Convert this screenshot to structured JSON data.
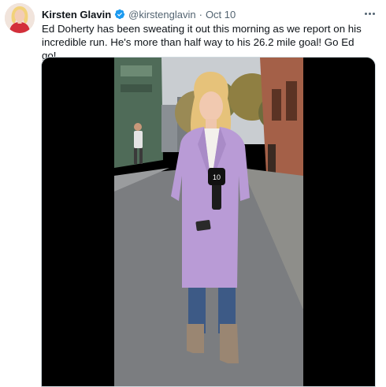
{
  "tweet": {
    "author_name": "Kirsten Glavin",
    "handle": "@kirstenglavin",
    "separator": "·",
    "date": "Oct 10",
    "text": "Ed Doherty has been sweating it out this morning as we report on his incredible run. He's more than half way to his 26.2 mile goal! Go Ed go!",
    "verified_icon": "verified-badge-icon",
    "more_icon": "more-options-icon"
  },
  "media": {
    "type": "video",
    "description_icon": "video-thumbnail",
    "mic_flag_label": "10"
  },
  "colors": {
    "text_primary": "#0f1419",
    "text_secondary": "#536471",
    "verified_blue": "#1d9bf0",
    "coat": "#b99bd6"
  }
}
